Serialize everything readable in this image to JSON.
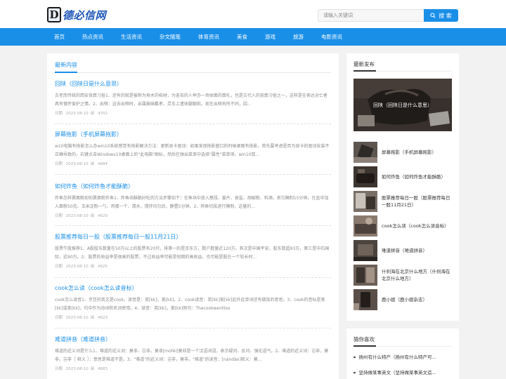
{
  "header": {
    "logo_mark": "D",
    "logo_text": "德必信网",
    "search_placeholder": "请输入关键词",
    "search_button": "搜 索"
  },
  "nav": [
    "首页",
    "热点资讯",
    "生活资讯",
    "杂文随笔",
    "体育资讯",
    "美食",
    "游戏",
    "旅游",
    "电影资讯"
  ],
  "main": {
    "section_title": "最新内容",
    "articles": [
      {
        "title": "回陕（回陕日是什么意思）",
        "excerpt": "古老而传统的西安丧葬习俗1、还有的就是被称为寿木的棺材，为逝去的人举办一场体面的葬礼，也是古代人的丧葬习俗之一，这样是在表达对亡者具有慎怀爱护之情。2、出殡：这去出殡时，亲属披麻戴孝，灵车上遗体腿朝前。现在出殡有所不同，因...",
        "date_label": "日期",
        "date": "2023-08-10",
        "views_label": "阅",
        "views": "4702"
      },
      {
        "title": "屏幕拖影（手机屏幕拖影）",
        "excerpt": "w10电脑有拖影怎么办win10系统感觉有拖影解决方法：更新显卡驱动：如果发现拖影窗口的时候桌面有拖影，首先要考虑是否为显卡的驱动安装不正确导致的，右键点击Windows10桌面上的\"此电脑\"图标，然后在弹出菜单中选择\"属性\"菜单项。win10鼠...",
        "date_label": "日期",
        "date": "2023-08-10",
        "views_label": "阅",
        "views": "4684"
      },
      {
        "title": "如何炸鱼（如何炸鱼才能酥脆）",
        "excerpt": "炸鱼怎样裹面粉如何裹面粉炸鱼1、炸鱼块酥脆好吃的方法步骤如下：在鱼块中放入葱段、姜片、食盐、胡椒粉、料酒，抓匀腌制15分钟。在盆中加入面粉50克、玉米淀粉一勺、鸡蛋一个、清水，搅拌均匀后，静置5分钟。2、将鱼切段进行腌制，这量的...",
        "date_label": "日期",
        "date": "2023-08-10",
        "views_label": "阅",
        "views": "4629"
      },
      {
        "title": "股票推荐每日一股（股票推荐每日一股11月21日）",
        "excerpt": "股票牛股推荐1、A股股东数量在50万以上的股票有20只，排第一的是京东方，数户数量近120万。其次是中国平安，股东数超93万，第三是中石国际，近90万。2、股票的收益率是很高的股票，不过收益率可能是短期的高收益，也可能是股在一个较长时...",
        "date_label": "日期",
        "date": "2023-08-10",
        "views_label": "阅",
        "views": "4625"
      },
      {
        "title": "cook怎么读（cook怎么读音标）",
        "excerpt": "cook怎么读音1、烹饪的英文是cook，读音是：英[kk]，美[kk]。2、cook读音：英[kk]美[kk]此外此单词还有做饭的意思。3、cook的音标是美[kk]或美[kk]，句中作为动词和名词使用。4、读音：英[kk]，美[kk]例句：Thecookwenttos",
        "date_label": "日期",
        "date": "2023-08-10",
        "views_label": "阅",
        "views": "4623"
      },
      {
        "title": "难道拼音（难道拼音）",
        "excerpt": "难道的近义词是什么1、难道的近义词：莫非、岂非。莫非[mòfēi]莫非是一个汉语词语，表示疑问、反问、强化语气。2、难道的近义词：岂非，莫非。岂非［ 释义 ］：意思是难道不是。3、\"难道\"的近义词：岂非，莫非。\"难道\"的读音：[nándào]释义：莫...",
        "date_label": "日期",
        "date": "2023-08-10",
        "views_label": "阅",
        "views": "4683"
      }
    ]
  },
  "sidebar": {
    "latest_title": "最新发布",
    "featured_caption": "回陕（回陕日是什么意思）",
    "latest_items": [
      "屏幕拖影（手机屏幕拖影）",
      "如何炸鱼（如何炸鱼才能酥脆）",
      "股票推荐每日一股（股票推荐每日一股11月21日）",
      "cook怎么读（cook怎么读音标）",
      "难道拼音（难道拼音）",
      "什刹海在北京什么地方（什刹海在北京什么地方）",
      "鹿小姐（鹿小姐杂志）"
    ],
    "guess_title": "猜你喜欢",
    "guess_items": [
      "扬州有什么特产（扬州有什么特产可...",
      "坚持做某事英文（坚持做某事英文造..."
    ]
  },
  "colors": {
    "accent": "#1a8fe8",
    "background": "#f2f2f2"
  }
}
